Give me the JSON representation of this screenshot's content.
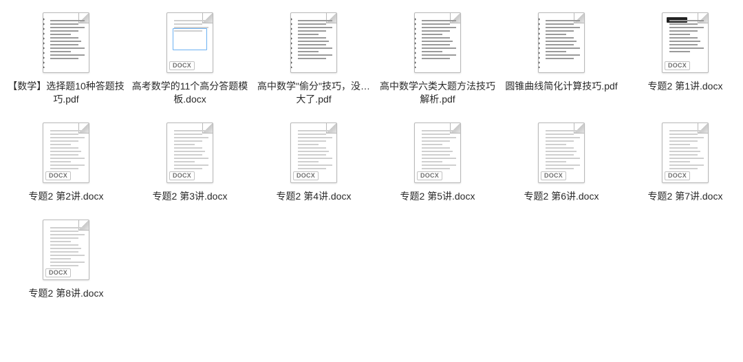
{
  "badge": {
    "docx": "DOCX"
  },
  "files": [
    {
      "name": "【数学】选择题10种答题技巧.pdf",
      "type": "pdf",
      "variant": "spiral"
    },
    {
      "name": "高考数学的11个高分答题模板.docx",
      "type": "docx",
      "variant": "bluebox"
    },
    {
      "name": "高中数学\"偷分\"技巧，没…大了.pdf",
      "type": "pdf",
      "variant": "spiral"
    },
    {
      "name": "高中数学六类大题方法技巧解析.pdf",
      "type": "pdf",
      "variant": "spiral"
    },
    {
      "name": "圆锥曲线简化计算技巧.pdf",
      "type": "pdf",
      "variant": "spiral"
    },
    {
      "name": "专题2 第1讲.docx",
      "type": "docx",
      "variant": "black-hdr"
    },
    {
      "name": "专题2 第2讲.docx",
      "type": "docx",
      "variant": "plain"
    },
    {
      "name": "专题2 第3讲.docx",
      "type": "docx",
      "variant": "plain"
    },
    {
      "name": "专题2 第4讲.docx",
      "type": "docx",
      "variant": "plain"
    },
    {
      "name": "专题2 第5讲.docx",
      "type": "docx",
      "variant": "plain"
    },
    {
      "name": "专题2 第6讲.docx",
      "type": "docx",
      "variant": "plain"
    },
    {
      "name": "专题2 第7讲.docx",
      "type": "docx",
      "variant": "plain"
    },
    {
      "name": "专题2 第8讲.docx",
      "type": "docx",
      "variant": "plain"
    }
  ]
}
